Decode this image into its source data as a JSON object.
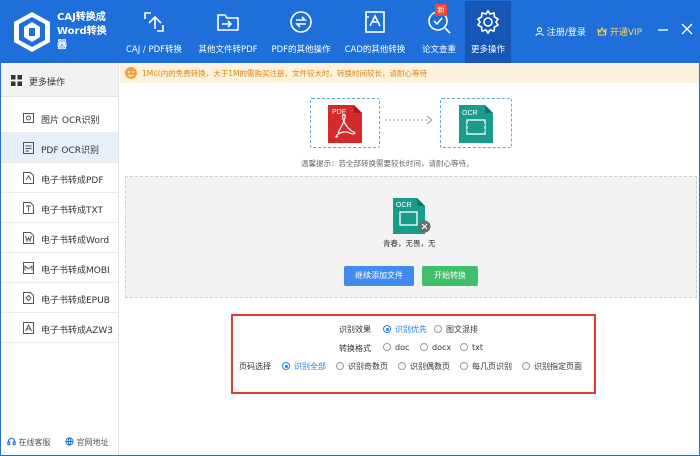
{
  "app": {
    "name_line1": "CAJ转换成",
    "name_line2": "Word转换",
    "name_line3": "器"
  },
  "nav": [
    {
      "label": "CAJ / PDF转换",
      "icon": "pdf-convert-icon"
    },
    {
      "label": "其他文件转PDF",
      "icon": "folder-icon"
    },
    {
      "label": "PDF的其他操作",
      "icon": "refresh-icon"
    },
    {
      "label": "CAD的其他转换",
      "icon": "cad-icon"
    },
    {
      "label": "论文查重",
      "icon": "check-search-icon",
      "badge": "新"
    },
    {
      "label": "更多操作",
      "icon": "gear-icon",
      "active": true
    }
  ],
  "header": {
    "login": "注册/登录",
    "vip": "开通VIP"
  },
  "sidebar": {
    "title": "更多操作",
    "items": [
      {
        "label": "图片 OCR识别",
        "icon": "image-ocr-icon"
      },
      {
        "label": "PDF OCR识别",
        "icon": "pdf-ocr-icon",
        "active": true
      },
      {
        "label": "电子书转成PDF",
        "icon": "pdf-file-icon"
      },
      {
        "label": "电子书转成TXT",
        "icon": "txt-file-icon"
      },
      {
        "label": "电子书转成Word",
        "icon": "word-file-icon"
      },
      {
        "label": "电子书转成MOBI",
        "icon": "mobi-file-icon"
      },
      {
        "label": "电子书转成EPUB",
        "icon": "epub-file-icon"
      },
      {
        "label": "电子书转成AZW3",
        "icon": "azw3-file-icon"
      }
    ],
    "footer_service": "在线客服",
    "footer_site": "官网地址"
  },
  "notice": "1M以内的免费转换，大于1M的需购买注册，文件较大时，转换时间较长，请耐心等待",
  "flow": {
    "from_label": "PDF",
    "to_label": "OCR"
  },
  "tip": "温馨提示：若全部转换需要较长时间，请耐心等待。",
  "file": {
    "badge": "OCR",
    "name": "青春，无畏，无"
  },
  "buttons": {
    "add": "继续添加文件",
    "start": "开始转换"
  },
  "options": {
    "effect_label": "识别效果",
    "effect": [
      {
        "label": "识别优先",
        "selected": true
      },
      {
        "label": "图文混排",
        "selected": false
      }
    ],
    "format_label": "转换格式",
    "format": [
      {
        "label": "doc",
        "selected": false
      },
      {
        "label": "docx",
        "selected": false
      },
      {
        "label": "txt",
        "selected": false
      }
    ],
    "pages_label": "页码选择",
    "pages": [
      {
        "label": "识别全部",
        "selected": true
      },
      {
        "label": "识别奇数页",
        "selected": false
      },
      {
        "label": "识别偶数页",
        "selected": false
      },
      {
        "label": "每几页识别",
        "selected": false
      },
      {
        "label": "识别指定页面",
        "selected": false
      }
    ]
  },
  "colors": {
    "header_bg": "#1e6fd9",
    "accent": "#1e7ef0",
    "start_button": "#3fbf6a",
    "add_button": "#3f8bef",
    "highlight_border": "#e53935",
    "pdf_red": "#d42a2a",
    "ocr_teal": "#1a9c8c"
  }
}
